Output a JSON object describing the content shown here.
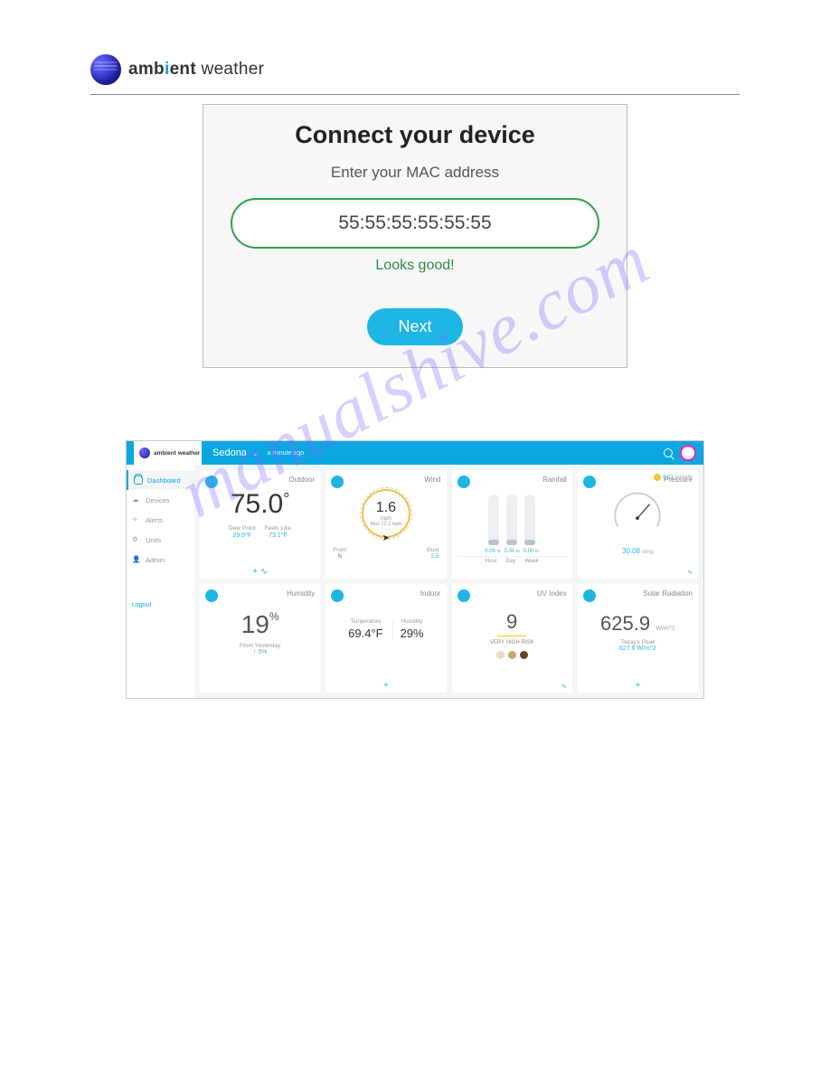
{
  "brand": {
    "part1": "amb",
    "dot": "i",
    "part2": "ent",
    "part3": " weather"
  },
  "connect": {
    "title": "Connect your device",
    "subtitle": "Enter your MAC address",
    "value": "55:55:55:55:55:55",
    "status": "Looks good!",
    "next": "Next"
  },
  "dashboard": {
    "logo": "ambient weather",
    "location": "Sedona",
    "updated": "a minute ago",
    "nav": {
      "dashboard": "Dashboard",
      "devices": "Devices",
      "alerts": "Alerts",
      "units": "Units",
      "admin": "Admin",
      "logout": "Logout"
    },
    "outdoor": {
      "title": "Outdoor",
      "temp": "75.0",
      "dewpoint_lbl": "Dew Point",
      "dewpoint": "29.9°F",
      "feels_lbl": "Feels Like",
      "feels": "73.1°F"
    },
    "wind": {
      "title": "Wind",
      "speed": "1.6",
      "unit": "mph",
      "max": "Max 12.3 mph",
      "from_lbl": "From",
      "from": "S",
      "gust_lbl": "Gust",
      "gust": "2.5"
    },
    "rain": {
      "title": "Rainfall",
      "hour": "0.00",
      "day": "0.00",
      "week": "0.00",
      "unit": "in",
      "hour_lbl": "Hour",
      "day_lbl": "Day",
      "week_lbl": "Week"
    },
    "pressure": {
      "title": "Pressure",
      "rate": "0.01",
      "rate_unit": "inHg/hr",
      "value": "30.08",
      "unit": "inHg"
    },
    "humidity": {
      "title": "Humidity",
      "value": "19",
      "sub": "From Yesterday",
      "change": "↑ 5%"
    },
    "indoor": {
      "title": "Indoor",
      "temp_lbl": "Temperature",
      "temp": "69.4°F",
      "hum_lbl": "Humidity",
      "hum": "29%"
    },
    "uv": {
      "title": "UV Index",
      "value": "9",
      "risk": "VERY HIGH RISK"
    },
    "solar": {
      "title": "Solar Radiation",
      "value": "625.9",
      "unit": "W/m^2",
      "peak_lbl": "Today's Peak",
      "peak": "627.6 W/m^2"
    }
  },
  "watermark": "manualshive.com"
}
